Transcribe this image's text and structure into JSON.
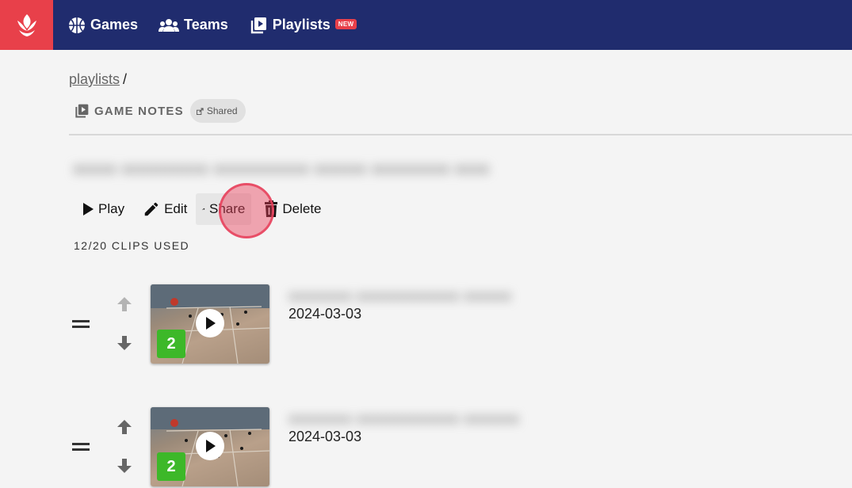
{
  "nav": {
    "logo_icon": "basketball-logo-icon",
    "items": [
      {
        "label": "Games",
        "icon": "basketball-icon"
      },
      {
        "label": "Teams",
        "icon": "people-icon"
      },
      {
        "label": "Playlists",
        "icon": "playlist-icon",
        "badge": "NEW"
      }
    ]
  },
  "breadcrumb": {
    "link": "playlists",
    "separator": "/"
  },
  "section": {
    "title": "GAME NOTES",
    "chip": "Shared"
  },
  "playlist": {
    "title_blurred": "xxxxx xxxxxxxxxx xxxxxxxxxxx xxxxxx xxxxxxxxx xxxx"
  },
  "actions": {
    "play": "Play",
    "edit": "Edit",
    "share": "Share",
    "delete": "Delete"
  },
  "clips_used": "12/20 CLIPS USED",
  "clips": [
    {
      "title_blurred": "xxxxxxxx xxxxxxxxxxxxx xxxxxx",
      "date": "2024-03-03",
      "count": "2"
    },
    {
      "title_blurred": "xxxxxxxx xxxxxxxxxxxxx xxxxxxx",
      "date": "2024-03-03",
      "count": "2"
    }
  ],
  "colors": {
    "topbar": "#202c6e",
    "logo_bg": "#e8404a",
    "badge_green": "#3db829",
    "new_badge": "#e8404a"
  }
}
